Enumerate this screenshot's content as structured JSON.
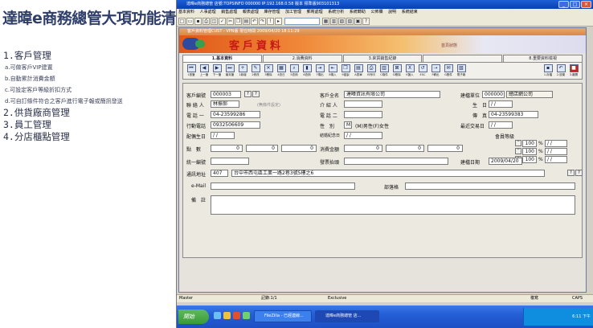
{
  "promo": {
    "title": "達暐e商務總管大項功能清單",
    "items": [
      {
        "text": "1.客戶管理",
        "level": "h"
      },
      {
        "text": "a.可做客戶VIP建置",
        "level": "s"
      },
      {
        "text": "b.自動累計消費金額",
        "level": "s"
      },
      {
        "text": "c.可設定客戶等級折扣方式",
        "level": "s"
      },
      {
        "text": "d.可自訂條件符合之客戶進行電子報或簡訊發送",
        "level": "s"
      },
      {
        "text": "2.供貨廠商管理",
        "level": "h"
      },
      {
        "text": "3.員工管理",
        "level": "h"
      },
      {
        "text": "4.分店櫃點管理",
        "level": "h"
      }
    ]
  },
  "window": {
    "title": "達暐e商務總管 店號:TOPSINFO 000000 IP:192.168.0.58 版本 標準版903101313",
    "menu": [
      "基本資料",
      "人事處理",
      "銷售處理",
      "報表處理",
      "庫存管理",
      "加工管理",
      "郵寄處理",
      "系統分析",
      "系統轉助",
      "公佈欄",
      "說明",
      "系統結束"
    ]
  },
  "child": {
    "title": "客戶資料管理CUST - VPN版  現在時間 2009/04/20 18:11:29",
    "banner_text": "客戶資料",
    "banner_right": "首頁狀態",
    "tabs": [
      "1.基本資料",
      "2.消費資料",
      "3.來貨銷售紀錄",
      "",
      "8.重要資料檢視"
    ],
    "nav": [
      "1首筆",
      "上一筆",
      "下一筆",
      "最末筆",
      "1新增",
      "2修改",
      "3刪除",
      "4查日",
      "5查詢",
      "6查詢",
      "7傳出",
      "8傳入",
      "9複製",
      "A表單",
      "B列印",
      "C條件",
      "D刪除",
      "E匯入",
      "ESC",
      "F轉出",
      "G郵件",
      "電子報"
    ],
    "nav_right": [
      "1.存檔",
      "2.放棄",
      "3.離開"
    ]
  },
  "form": {
    "cust_no_label": "客戶編號",
    "cust_no": "000003",
    "full_name_label": "客戶全名",
    "full_name": "達暐資訊有限公司",
    "unit_label": "建檔單位",
    "unit_code": "000000",
    "unit_name": "總店網公司",
    "contact_label": "聯 絡 人",
    "contact": "林振郝",
    "contact_note": "(無條件設定)",
    "referrer_label": "介 紹 人",
    "referrer": "",
    "birthday_label": "生　日",
    "birthday": "/ /",
    "phone1_label": "電 話 一",
    "phone1": "04-23599286",
    "phone2_label": "電 話 二",
    "phone2": "",
    "fax_label": "傳　真",
    "fax": "04-23599383",
    "mobile_label": "行動電話",
    "mobile": "0932506609",
    "gender_label": "性　別",
    "gender": "M",
    "gender_note": "(M)男性(F)女性",
    "last_trade_label": "最近交易日",
    "last_trade": "/ /",
    "spouse_bday_label": "配偶生日",
    "spouse_bday": "/ /",
    "anniversary_label": "結婚紀念日",
    "anniversary": "/ /",
    "member_level_label": "會員等級",
    "points_label": "點　數",
    "points": [
      "0",
      "0",
      "0"
    ],
    "spend_label": "消費金額",
    "spend": [
      "0",
      "0",
      "0"
    ],
    "level_rows": [
      {
        "pct": "100",
        "date": "/ /"
      },
      {
        "pct": "100",
        "date": "/ /"
      },
      {
        "pct": "100",
        "date": "/ /"
      }
    ],
    "tax_id_label": "統一編號",
    "tax_id": "",
    "invoice_label": "發票抬頭",
    "invoice": "",
    "created_label": "建檔日期",
    "created": "2009/04/20",
    "address_label": "通訊地址",
    "zip": "407",
    "address": "台中市西屯區工業一路2巷3號5樓之6",
    "email_label": "e-Mail",
    "email": "",
    "blog_label": "部落格",
    "blog": "",
    "remarks_label": "備　註",
    "remarks": ""
  },
  "status": {
    "left": "Master",
    "record": "記錄:1/1",
    "mode": "Exclusive",
    "right1": "複寫",
    "right2": "CAPS"
  },
  "taskbar": {
    "start": "開始",
    "tasks": [
      "FileZilla - 已經連線...",
      "達暐e商務總管 店..."
    ],
    "time": "6:11 下午"
  }
}
